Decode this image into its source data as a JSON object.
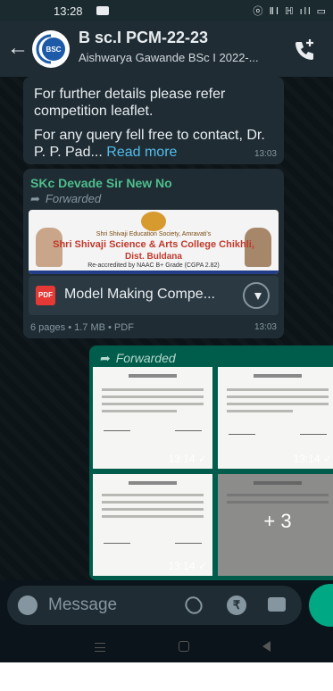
{
  "status": {
    "time": "13:28",
    "icons": "ⓞ ⅡⅠ ℍ ıll ▭"
  },
  "header": {
    "title": "B sc.I PCM-22-23",
    "subtitle": "Aishwarya Gawande BSc I 2022-..."
  },
  "messages": {
    "m1": {
      "line1": "For further details please refer competition leaflet.",
      "line2_text": "For any query fell free to contact, Dr. P. P. Pad...",
      "read_more": "Read more",
      "time": "13:03"
    },
    "m2": {
      "sender": "SKc Devade Sir New No",
      "forwarded": "Forwarded",
      "preview": {
        "line1": "Shri Shivaji Education Society, Amravati's",
        "line2": "Shri Shivaji Science & Arts College Chikhli,",
        "line3": "Dist. Buldana",
        "line4": "Re-accredited by NAAC B+ Grade (CGPA 2.82)"
      },
      "doc_name": "Model Making Compe...",
      "doc_meta": "6 pages • 1.7 MB • PDF",
      "time": "13:03",
      "pdf_label": "PDF"
    },
    "m3": {
      "forwarded": "Forwarded",
      "tile_times": [
        "13:14 ✓",
        "13:14 ✓",
        "13:14 ✓"
      ],
      "more": "+ 3"
    }
  },
  "input": {
    "placeholder": "Message",
    "rupee": "₹"
  },
  "colors": {
    "accent": "#00a884",
    "bubble_in": "#1f2c34",
    "bubble_out": "#005c4b",
    "link": "#53bdeb"
  }
}
